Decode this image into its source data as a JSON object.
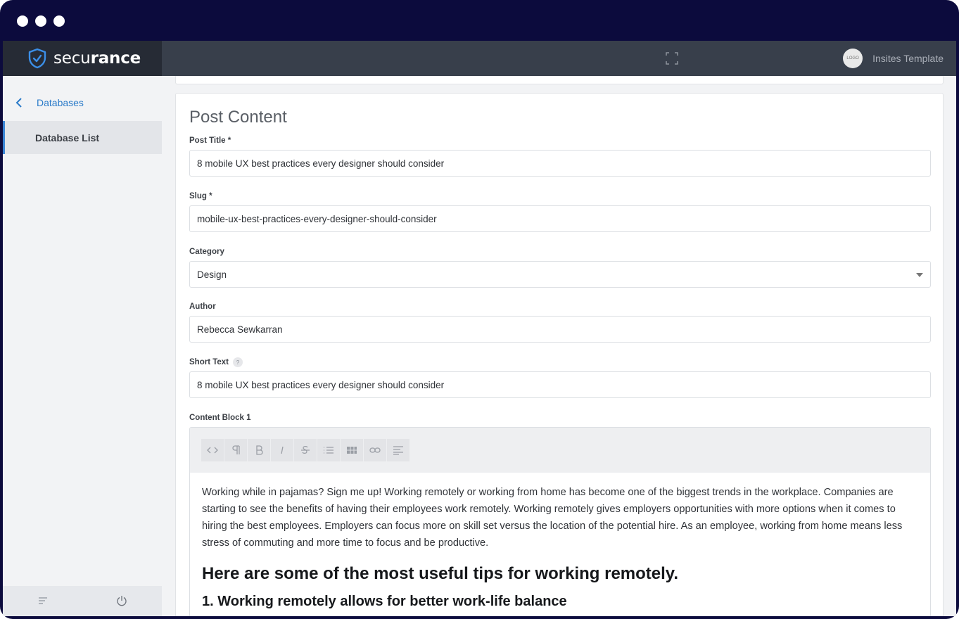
{
  "brand": {
    "name_regular": "secu",
    "name_bold": "rance"
  },
  "header": {
    "avatar_text": "LOGO",
    "user_name": "Insites Template"
  },
  "sidebar": {
    "back_label": "Databases",
    "items": [
      {
        "label": "Database List",
        "active": true
      }
    ]
  },
  "form": {
    "title": "Post Content",
    "post_title": {
      "label": "Post Title *",
      "value": "8 mobile UX best practices every designer should consider"
    },
    "slug": {
      "label": "Slug *",
      "value": "mobile-ux-best-practices-every-designer-should-consider"
    },
    "category": {
      "label": "Category",
      "value": "Design"
    },
    "author": {
      "label": "Author",
      "value": "Rebecca Sewkarran"
    },
    "short_text": {
      "label": "Short Text",
      "help": "?",
      "value": "8 mobile UX best practices every designer should consider"
    },
    "content_block": {
      "label": "Content Block 1",
      "toolbar": [
        "code",
        "paragraph",
        "bold",
        "italic",
        "strikethrough",
        "unordered-list",
        "table",
        "link",
        "align"
      ],
      "paragraph": "Working while in pajamas? Sign me up! Working remotely or working from home has become one of the biggest trends in the workplace. Companies are starting to see the benefits of having their employees work remotely. Working remotely gives employers opportunities with more options when it comes to hiring the best employees. Employers can focus more on skill set versus the location of the potential hire. As an employee, working from home means less stress of commuting and more time to focus and be productive.",
      "heading": "Here are some of the most useful tips for working remotely.",
      "subheading": "1. Working remotely allows for better work-life balance"
    }
  },
  "colors": {
    "frame": "#0c0b3d",
    "accent": "#3b86d6",
    "topbar": "#383f4b",
    "brand_bg": "#262b35"
  }
}
